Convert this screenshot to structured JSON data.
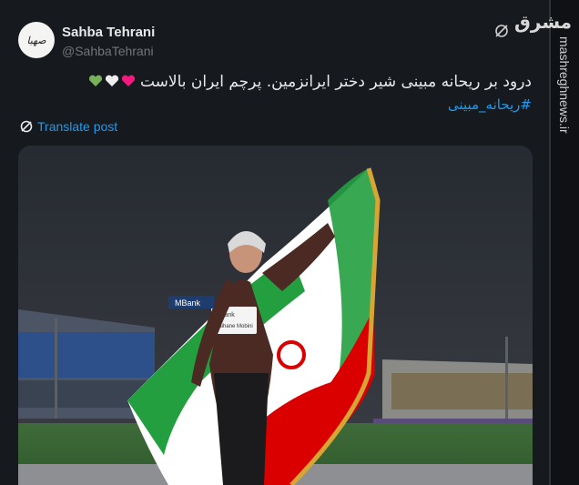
{
  "author": {
    "name": "Sahba Tehrani",
    "handle": "@SahbaTehrani",
    "avatar_text": "صهبا"
  },
  "post": {
    "text": "درود بر ریحانه مبینی شیر دختر ایرانزمین. پرچم ایران بالاست",
    "hashtag": "#ریحانه_مبینی",
    "translate_label": "Translate post"
  },
  "photo": {
    "bib_top": "MBank",
    "bib_name": "Raihane Mobini",
    "banner_text": "MBank"
  },
  "watermark": {
    "logo_text": "مشرق",
    "site": "mashreghnews.ir"
  },
  "colors": {
    "accent": "#1d9bf0",
    "flag_green": "#239f40",
    "flag_red": "#da0000"
  }
}
